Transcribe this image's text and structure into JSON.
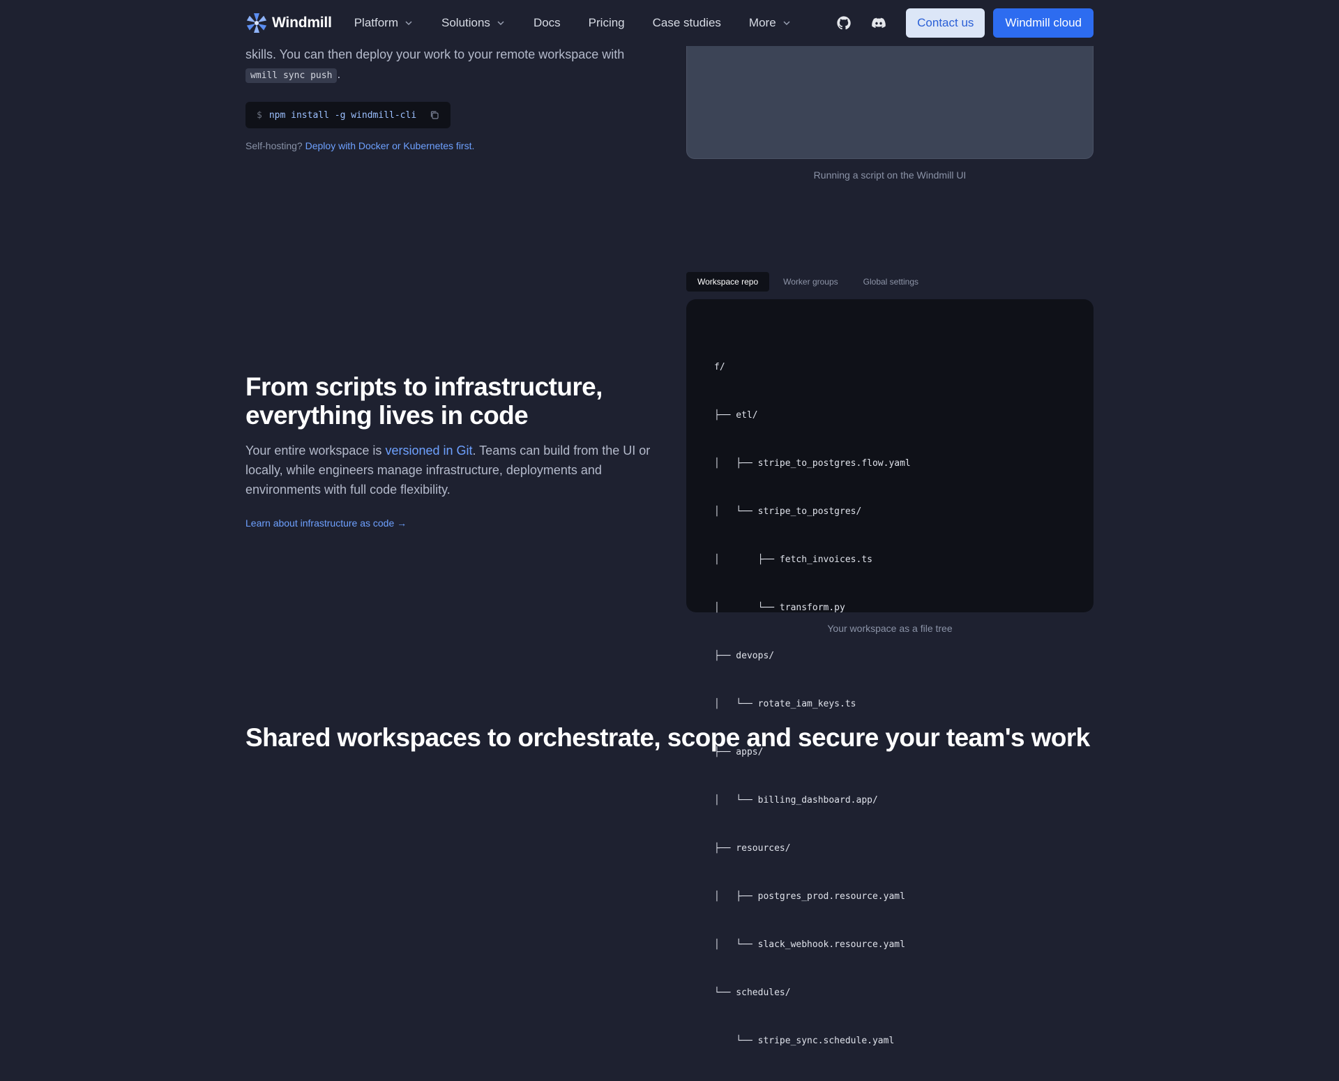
{
  "nav": {
    "brand": "Windmill",
    "items": [
      {
        "label": "Platform",
        "dropdown": true
      },
      {
        "label": "Solutions",
        "dropdown": true
      },
      {
        "label": "Docs",
        "dropdown": false
      },
      {
        "label": "Pricing",
        "dropdown": false
      },
      {
        "label": "Case studies",
        "dropdown": false
      },
      {
        "label": "More",
        "dropdown": true
      }
    ],
    "icons": [
      "github-icon",
      "discord-icon"
    ],
    "contact_label": "Contact us",
    "cloud_label": "Windmill cloud"
  },
  "intro": {
    "text_before": "skills. You can then deploy your work to your remote workspace with ",
    "code": "wmill sync push",
    "text_after": "."
  },
  "install": {
    "prompt": "$",
    "command": "npm install -g windmill-cli"
  },
  "selfhost": {
    "prefix": "Self-hosting? ",
    "link": "Deploy with Docker or Kubernetes first."
  },
  "preview": {
    "caption": "Running a script on the Windmill UI"
  },
  "tabs": [
    {
      "label": "Workspace repo",
      "active": true
    },
    {
      "label": "Worker groups",
      "active": false
    },
    {
      "label": "Global settings",
      "active": false
    }
  ],
  "file_tree": {
    "lines": [
      "f/",
      "├── etl/",
      "│   ├── stripe_to_postgres.flow.yaml",
      "│   └── stripe_to_postgres/",
      "│       ├── fetch_invoices.ts",
      "│       └── transform.py",
      "├── devops/",
      "│   └── rotate_iam_keys.ts",
      "├── apps/",
      "│   └── billing_dashboard.app/",
      "├── resources/",
      "│   ├── postgres_prod.resource.yaml",
      "│   └── slack_webhook.resource.yaml",
      "└── schedules/",
      "    └── stripe_sync.schedule.yaml"
    ],
    "caption": "Your workspace as a file tree"
  },
  "infra": {
    "title_line1": "From scripts to infrastructure,",
    "title_line2": "everything lives in code",
    "body_before": "Your entire workspace is ",
    "body_link": "versioned in Git",
    "body_after": ". Teams can build from the UI or locally, while engineers manage infrastructure, deployments and environments with full code flexibility.",
    "learn_link": "Learn about infrastructure as code →"
  },
  "shared": {
    "title": "Shared workspaces to orchestrate, scope and secure your team's work"
  },
  "colors": {
    "background": "#1e2130",
    "accent": "#2d6cf0",
    "link": "#6ea1ff",
    "code_bg": "#0f1118"
  }
}
